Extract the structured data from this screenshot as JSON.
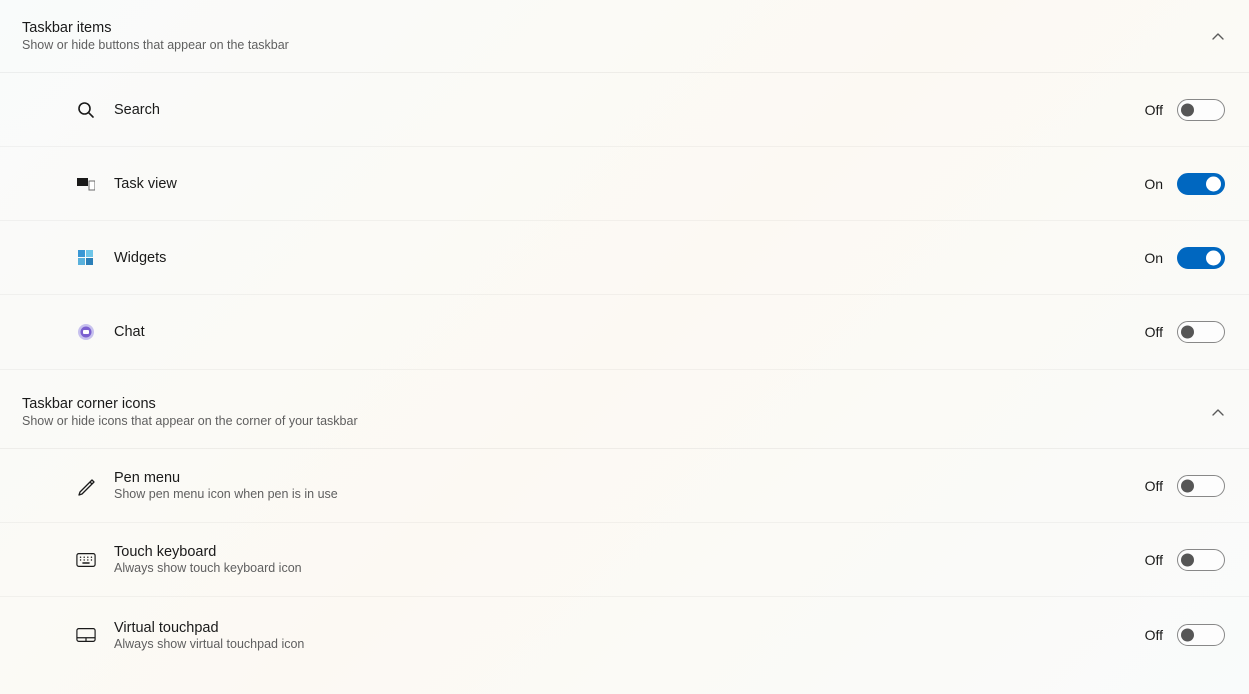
{
  "sections": {
    "taskbar_items": {
      "title": "Taskbar items",
      "subtitle": "Show or hide buttons that appear on the taskbar",
      "rows": {
        "search": {
          "label": "Search",
          "state": "Off"
        },
        "task_view": {
          "label": "Task view",
          "state": "On"
        },
        "widgets": {
          "label": "Widgets",
          "state": "On"
        },
        "chat": {
          "label": "Chat",
          "state": "Off"
        }
      }
    },
    "corner_icons": {
      "title": "Taskbar corner icons",
      "subtitle": "Show or hide icons that appear on the corner of your taskbar",
      "rows": {
        "pen": {
          "label": "Pen menu",
          "sub": "Show pen menu icon when pen is in use",
          "state": "Off"
        },
        "keyboard": {
          "label": "Touch keyboard",
          "sub": "Always show touch keyboard icon",
          "state": "Off"
        },
        "touchpad": {
          "label": "Virtual touchpad",
          "sub": "Always show virtual touchpad icon",
          "state": "Off"
        }
      }
    }
  }
}
